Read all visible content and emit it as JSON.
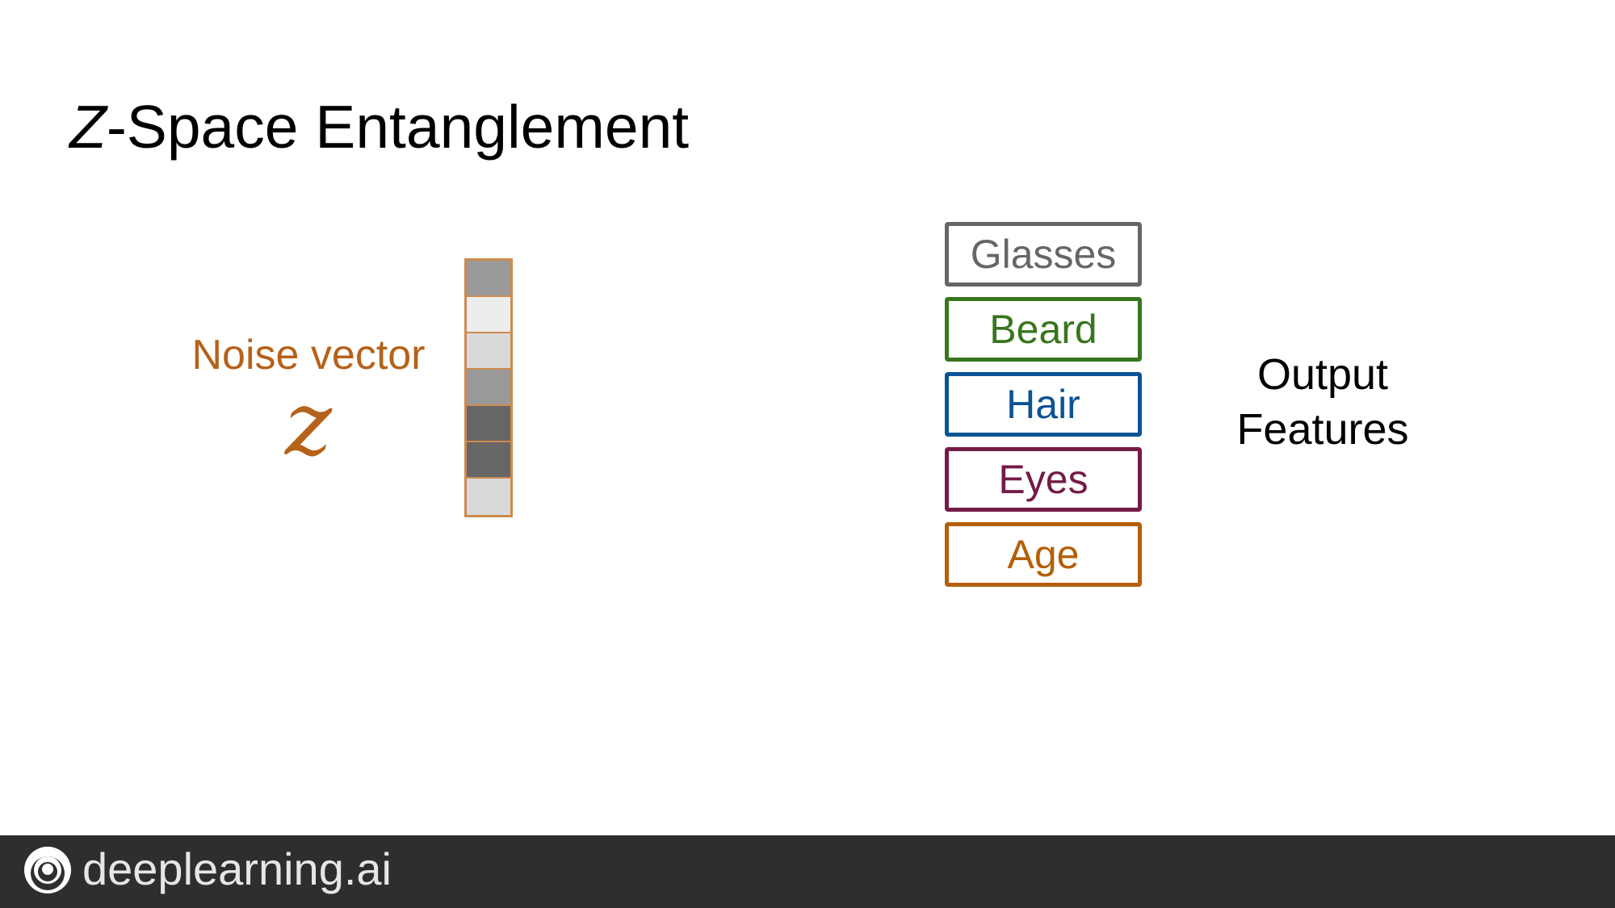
{
  "slide": {
    "title_italic": "Z",
    "title_rest": "-Space Entanglement"
  },
  "noise": {
    "label": "Noise vector",
    "symbol": "z",
    "color": "#b5621a",
    "vector_border_color": "#cd8b4c",
    "cells": [
      "#9a9a9a",
      "#ededed",
      "#d9d9d9",
      "#999999",
      "#666666",
      "#666666",
      "#d9d9d9"
    ]
  },
  "features": [
    {
      "label": "Glasses",
      "color": "#666666"
    },
    {
      "label": "Beard",
      "color": "#38761d"
    },
    {
      "label": "Hair",
      "color": "#0b5394"
    },
    {
      "label": "Eyes",
      "color": "#741b47"
    },
    {
      "label": "Age",
      "color": "#b45f06"
    }
  ],
  "output_label": {
    "line1": "Output",
    "line2": "Features"
  },
  "footer": {
    "brand": "deeplearning.ai",
    "logo_icon": "deeplearning-logo-icon",
    "background": "#2e2e2e"
  }
}
